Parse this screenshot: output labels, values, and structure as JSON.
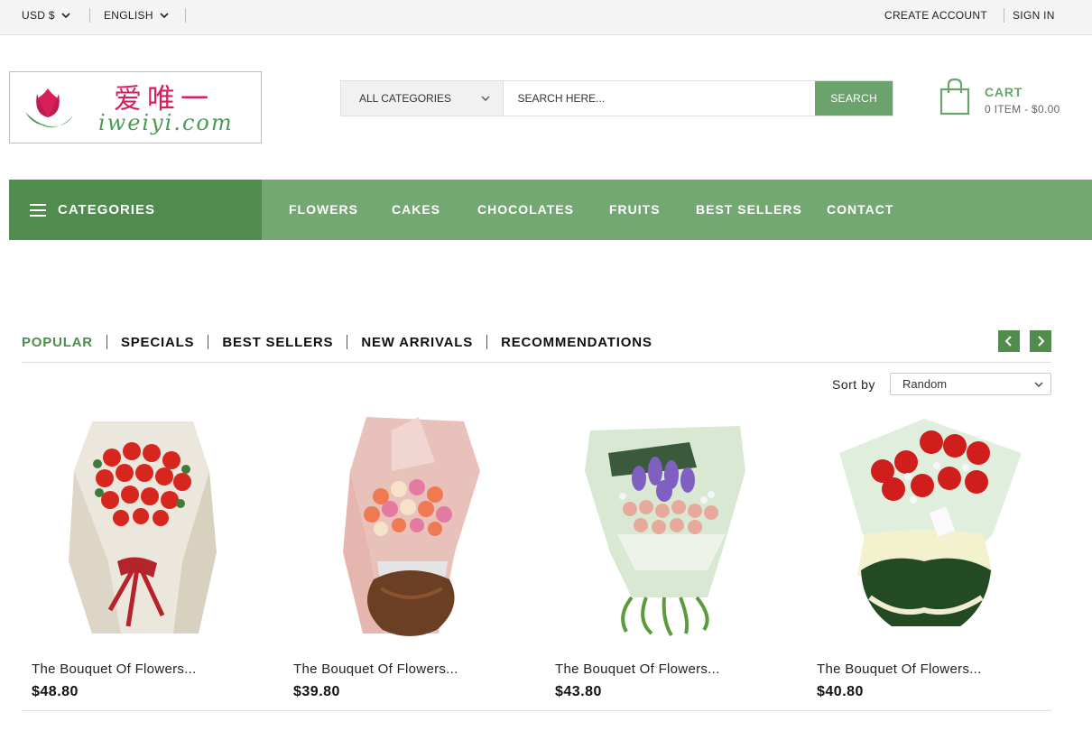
{
  "topbar": {
    "currency": "USD $",
    "language": "ENGLISH",
    "create_account": "CREATE ACCOUNT",
    "sign_in": "SIGN IN"
  },
  "logo": {
    "chinese": "爱唯一",
    "domain": "iweiyi.com"
  },
  "search": {
    "category": "ALL CATEGORIES",
    "placeholder": "SEARCH HERE...",
    "button": "SEARCH"
  },
  "cart": {
    "title": "CART",
    "summary": "0 ITEM - $0.00"
  },
  "nav": {
    "categories": "CATEGORIES",
    "items": [
      "FLOWERS",
      "CAKES",
      "CHOCOLATES",
      "FRUITS",
      "BEST SELLERS",
      "CONTACT"
    ]
  },
  "tabs": {
    "items": [
      "POPULAR",
      "SPECIALS",
      "BEST SELLERS",
      "NEW ARRIVALS",
      "RECOMMENDATIONS"
    ],
    "active": "POPULAR"
  },
  "sort": {
    "label": "Sort by",
    "value": "Random"
  },
  "products": [
    {
      "name": "The Bouquet Of Flowers...",
      "price": "$48.80",
      "image": "red-roses-bouquet"
    },
    {
      "name": "The Bouquet Of Flowers...",
      "price": "$39.80",
      "image": "mixed-roses-bouquet"
    },
    {
      "name": "The Bouquet Of Flowers...",
      "price": "$43.80",
      "image": "purple-stock-bouquet"
    },
    {
      "name": "The Bouquet Of Flowers...",
      "price": "$40.80",
      "image": "red-roses-white-wrap-bouquet"
    }
  ],
  "colors": {
    "brand_green": "#6aa36c",
    "nav_green": "#74a872",
    "dark_green": "#4f8c4e",
    "logo_pink": "#d7205a"
  }
}
